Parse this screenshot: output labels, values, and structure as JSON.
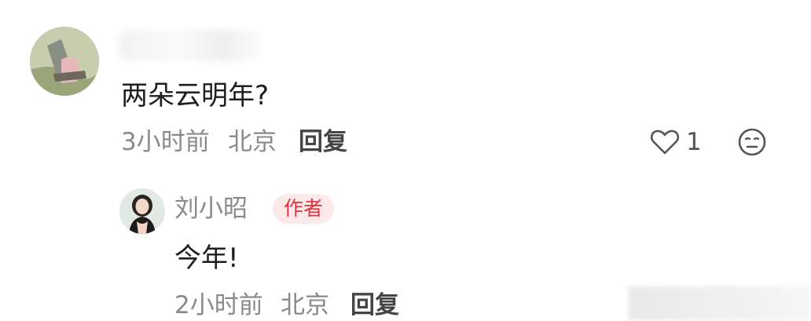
{
  "comments": [
    {
      "text": "两朵云明年?",
      "time": "3小时前",
      "location": "北京",
      "reply_label": "回复",
      "like_count": "1",
      "icons": [
        "heart-outline-icon",
        "meh-face-icon"
      ]
    }
  ],
  "reply": {
    "username": "刘小昭",
    "badge": "作者",
    "text": "今年!",
    "time": "2小时前",
    "location": "北京",
    "reply_label": "回复"
  },
  "colors": {
    "badge_bg": "#fde9ea",
    "badge_text": "#e0323c",
    "meta_text": "#8a8a8a"
  }
}
